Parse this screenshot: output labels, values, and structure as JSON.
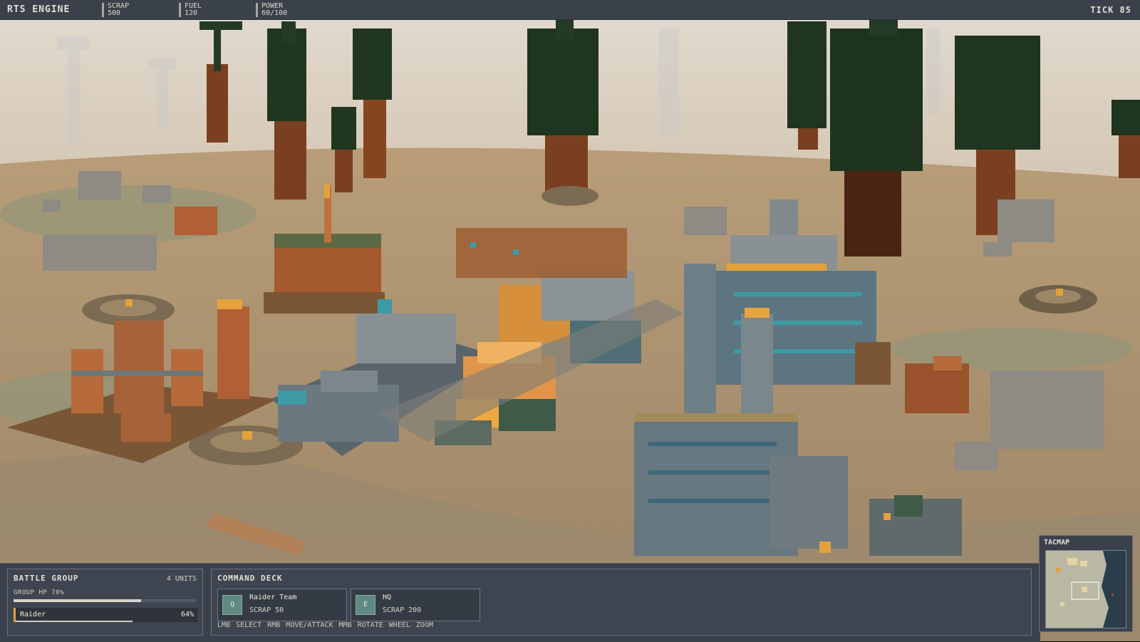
{
  "hud": {
    "title": "RTS ENGINE",
    "tick": "TICK 85",
    "resources": [
      {
        "label": "SCRAP",
        "value": "500"
      },
      {
        "label": "FUEL",
        "value": "120"
      },
      {
        "label": "POWER",
        "value": "60/100"
      }
    ]
  },
  "battle_group": {
    "title": "BATTLE GROUP",
    "units_count": "4 UNITS",
    "group_hp_label": "GROUP HP 70%",
    "group_hp_fraction": 0.7,
    "selected_unit": {
      "name": "Raider",
      "hp_label": "64%",
      "hp_fraction": 0.64
    }
  },
  "command_deck": {
    "title": "COMMAND DECK",
    "cards": [
      {
        "key": "Q",
        "name": "Raider Team",
        "cost": "SCRAP 50"
      },
      {
        "key": "E",
        "name": "HQ",
        "cost": "SCRAP 200"
      }
    ],
    "hints": "LMB SELECT  RMB MOVE/ATTACK  MMB ROTATE  WHEEL ZOOM"
  },
  "tacmap": {
    "label": "TACMAP"
  },
  "colors": {
    "hud_bg": "#3b414b",
    "accent_orange": "#e3a23c",
    "teal": "#3d9ba5",
    "sand": "#a78e6c",
    "sky": "#ded7cb"
  },
  "icons": [
    "tree-icon",
    "building-icon",
    "rock-icon"
  ]
}
